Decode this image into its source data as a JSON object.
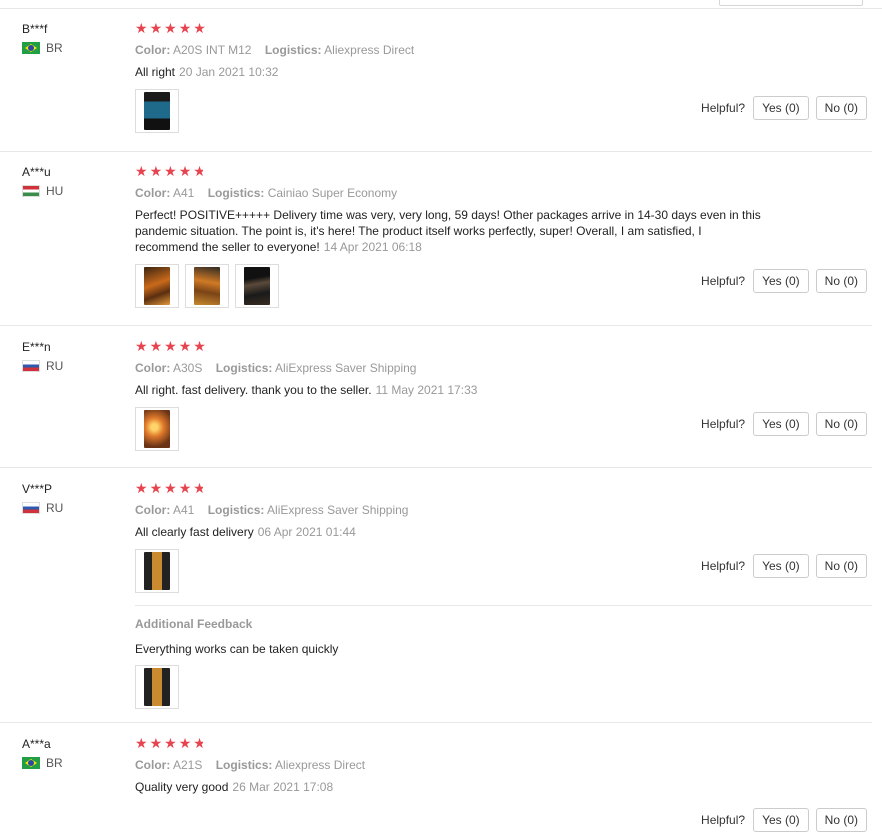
{
  "helpful_label": "Helpful?",
  "star_color": "#e8444f",
  "reviews": [
    {
      "user": "B***f",
      "country": "BR",
      "flag": "brazil-flag",
      "rating": 5,
      "color_label": "Color:",
      "color": "A20S INT M12",
      "logistics_label": "Logistics:",
      "logistics": "Aliexpress Direct",
      "text": "All right",
      "date": "20 Jan 2021 10:32",
      "yes": "Yes (0)",
      "no": "No (0)"
    },
    {
      "user": "A***u",
      "country": "HU",
      "flag": "hungary-flag",
      "rating": 4.5,
      "color_label": "Color:",
      "color": "A41",
      "logistics_label": "Logistics:",
      "logistics": "Cainiao Super Economy",
      "text": "Perfect! POSITIVE+++++ Delivery time was very, very long, 59 days! Other packages arrive in 14-30 days even in this pandemic situation. The point is, it's here! The product itself works perfectly, super! Overall, I am satisfied, I recommend the seller to everyone!",
      "date": "14 Apr 2021 06:18",
      "yes": "Yes (0)",
      "no": "No (0)"
    },
    {
      "user": "E***n",
      "country": "RU",
      "flag": "russia-flag",
      "rating": 5,
      "color_label": "Color:",
      "color": "A30S",
      "logistics_label": "Logistics:",
      "logistics": "AliExpress Saver Shipping",
      "text": "All right. fast delivery. thank you to the seller.",
      "date": "11 May 2021 17:33",
      "yes": "Yes (0)",
      "no": "No (0)"
    },
    {
      "user": "V***P",
      "country": "RU",
      "flag": "russia-flag",
      "rating": 4.5,
      "color_label": "Color:",
      "color": "A41",
      "logistics_label": "Logistics:",
      "logistics": "AliExpress Saver Shipping",
      "text": "All clearly fast delivery",
      "date": "06 Apr 2021 01:44",
      "yes": "Yes (0)",
      "no": "No (0)",
      "additional_title": "Additional Feedback",
      "additional_text": "Everything works can be taken quickly"
    },
    {
      "user": "A***a",
      "country": "BR",
      "flag": "brazil-flag",
      "rating": 4.5,
      "color_label": "Color:",
      "color": "A21S",
      "logistics_label": "Logistics:",
      "logistics": "Aliexpress Direct",
      "text": "Quality very good",
      "date": "26 Mar 2021 17:08",
      "yes": "Yes (0)",
      "no": "No (0)"
    }
  ]
}
